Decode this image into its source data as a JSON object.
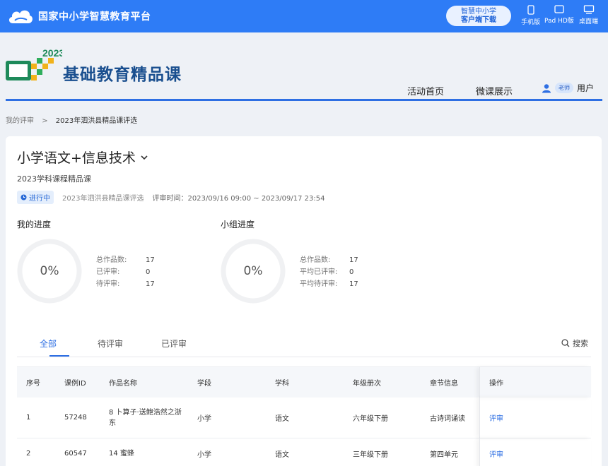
{
  "topbar": {
    "brand": "国家中小学智慧教育平台",
    "download_line1": "智慧中小学",
    "download_line2": "客户端下载",
    "devices": [
      "手机版",
      "Pad HD版",
      "桌面端"
    ]
  },
  "header": {
    "logo_year": "2023",
    "logo_text": "基础教育精品课",
    "nav": [
      "活动首页",
      "微课展示"
    ],
    "user_badge": "老师",
    "user_name": "用户"
  },
  "breadcrumb": {
    "root": "我的评审",
    "sep": ">",
    "current": "2023年泗洪县精品课评选"
  },
  "card": {
    "title": "小学语文+信息技术",
    "subtitle": "2023学科课程精品课",
    "status": "进行中",
    "contest": "2023年泗洪县精品课评选",
    "time": "评审时间：2023/09/16 09:00 ~ 2023/09/17 23:54"
  },
  "my_progress": {
    "title": "我的进度",
    "percent_label": "0%",
    "percent": 0,
    "stats": [
      {
        "label": "总作品数:",
        "value": "17"
      },
      {
        "label": "已评审:",
        "value": "0"
      },
      {
        "label": "待评审:",
        "value": "17"
      }
    ]
  },
  "group_progress": {
    "title": "小组进度",
    "percent_label": "0%",
    "percent": 0,
    "stats": [
      {
        "label": "总作品数:",
        "value": "17"
      },
      {
        "label": "平均已评审:",
        "value": "0"
      },
      {
        "label": "平均待评审:",
        "value": "17"
      }
    ]
  },
  "tabs": [
    "全部",
    "待评审",
    "已评审"
  ],
  "search_label": "搜索",
  "table": {
    "headers": [
      "序号",
      "课例ID",
      "作品名称",
      "学段",
      "学科",
      "年级册次",
      "章节信息",
      "操作"
    ],
    "rows": [
      [
        "1",
        "57248",
        "8 卜算子·送鲍浩然之浙东",
        "小学",
        "语文",
        "六年级下册",
        "古诗词诵读",
        "评审"
      ],
      [
        "2",
        "60547",
        "14 蜜蜂",
        "小学",
        "语文",
        "三年级下册",
        "第四单元",
        "评审"
      ]
    ]
  },
  "colors": {
    "primary": "#2e7cf6",
    "accent": "#2e6fe3",
    "logo_navy": "#1a4f8f"
  }
}
